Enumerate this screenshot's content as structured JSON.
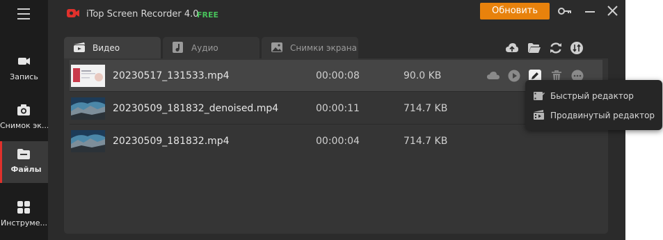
{
  "sidebar": {
    "items": [
      {
        "label": "Запись",
        "icon": "video-camera-icon"
      },
      {
        "label": "Снимок эк...",
        "icon": "camera-icon"
      },
      {
        "label": "Файлы",
        "icon": "folder-icon",
        "active": true
      },
      {
        "label": "Инструме...",
        "icon": "grid-icon"
      }
    ]
  },
  "titlebar": {
    "title": "iTop Screen Recorder 4.0",
    "badge": "FREE",
    "update_label": "Обновить"
  },
  "tabs": [
    {
      "label": "Видео",
      "icon": "clapper-icon",
      "active": true
    },
    {
      "label": "Аудио",
      "icon": "music-note-icon"
    },
    {
      "label": "Снимки экрана",
      "icon": "image-icon"
    }
  ],
  "files": [
    {
      "name": "20230517_131533.mp4",
      "duration": "00:00:08",
      "size": "90.0 KB"
    },
    {
      "name": "20230509_181832_denoised.mp4",
      "duration": "00:00:11",
      "size": "714.7 KB"
    },
    {
      "name": "20230509_181832.mp4",
      "duration": "00:00:04",
      "size": "714.7 KB"
    }
  ],
  "context_menu": {
    "items": [
      {
        "label": "Быстрый редактор"
      },
      {
        "label": "Продвинутый редактор"
      }
    ]
  },
  "colors": {
    "accent": "#e8820c",
    "free": "#47c25a",
    "active_marker": "#e0312c"
  }
}
